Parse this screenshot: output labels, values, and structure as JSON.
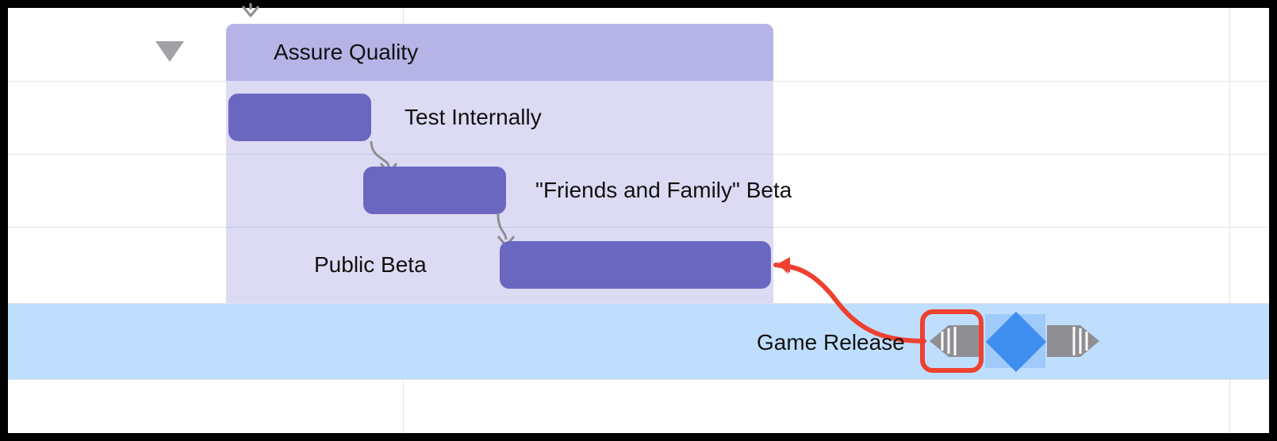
{
  "group": {
    "title": "Assure Quality",
    "tasks": [
      {
        "label": "Test Internally"
      },
      {
        "label": "\"Friends and Family\" Beta"
      },
      {
        "label": "Public Beta"
      }
    ]
  },
  "milestone": {
    "label": "Game Release"
  },
  "colors": {
    "group_header": "#b6b4e6",
    "group_bg": "#dcdbf3",
    "task_bar": "#6a67c0",
    "milestone_row": "#bfdefe",
    "milestone_diamond": "#3f8ff0",
    "highlight": "#ef4030",
    "grid": "#e5e5ea"
  }
}
